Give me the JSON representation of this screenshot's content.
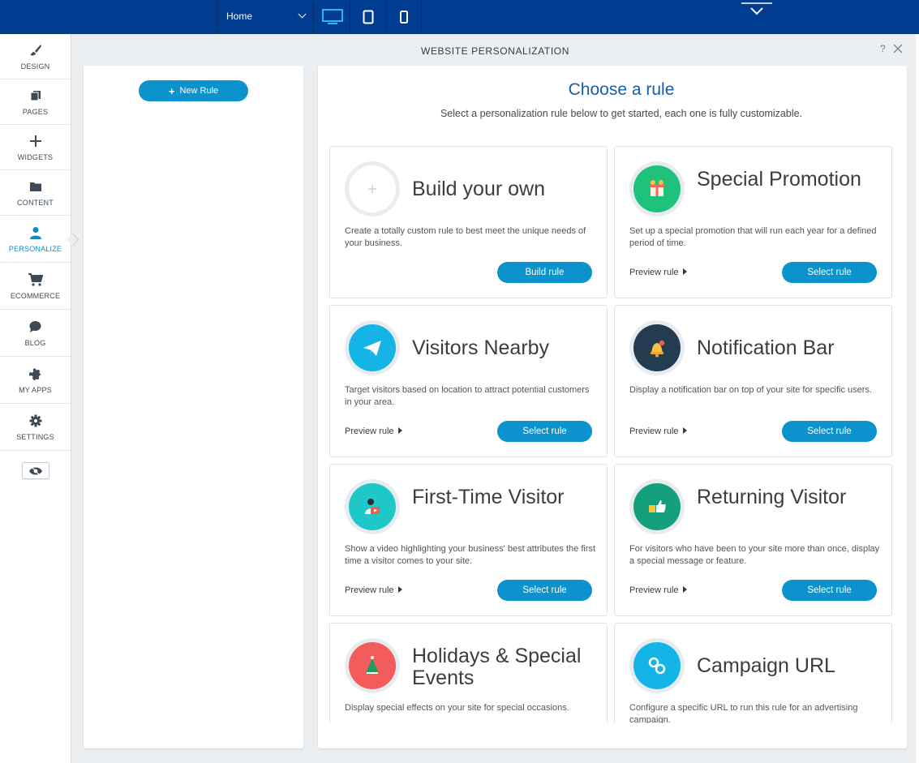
{
  "topbar": {
    "page_select_value": "Home",
    "devices": [
      "desktop-icon",
      "tablet-icon",
      "mobile-icon"
    ],
    "active_device": "desktop",
    "bg_color": "#003c8f"
  },
  "sidebar": {
    "items": [
      {
        "label": "DESIGN",
        "icon": "paintbrush-icon"
      },
      {
        "label": "PAGES",
        "icon": "pages-icon"
      },
      {
        "label": "WIDGETS",
        "icon": "plus-icon"
      },
      {
        "label": "CONTENT",
        "icon": "folder-icon"
      },
      {
        "label": "PERSONALIZE",
        "icon": "person-icon",
        "active": true
      },
      {
        "label": "ECOMMERCE",
        "icon": "cart-icon"
      },
      {
        "label": "BLOG",
        "icon": "chat-bubble-icon"
      },
      {
        "label": "MY APPS",
        "icon": "puzzle-icon"
      },
      {
        "label": "SETTINGS",
        "icon": "gear-icon"
      }
    ],
    "preview_icon": "eye-icon"
  },
  "panel": {
    "title": "WEBSITE PERSONALIZATION",
    "help": "?"
  },
  "rules_panel": {
    "new_rule_label": "New Rule"
  },
  "main": {
    "title": "Choose a rule",
    "subtitle": "Select a personalization rule below to get started, each one is fully customizable.",
    "preview_label": "Preview rule",
    "select_label": "Select rule",
    "build_label": "Build rule",
    "cards": [
      {
        "title": "Build your own",
        "desc": "Create a totally custom rule to best meet the unique needs of your business.",
        "icon": "plus-circle-icon",
        "color": "#ffffff"
      },
      {
        "title": "Special Promotion",
        "desc": "Set up a special promotion that will run each year for a defined period of time.",
        "icon": "gift-icon",
        "color": "#1fc27d"
      },
      {
        "title": "Visitors Nearby",
        "desc": "Target visitors based on location to attract potential customers in your area.",
        "icon": "paper-plane-icon",
        "color": "#14b5e6"
      },
      {
        "title": "Notification Bar",
        "desc": "Display a notification bar on top of your site for specific users.",
        "icon": "bell-icon",
        "color": "#233c52"
      },
      {
        "title": "First-Time Visitor",
        "desc": "Show a video highlighting your business' best attributes the first time a visitor comes to your site.",
        "icon": "video-person-icon",
        "color": "#1ec8c8"
      },
      {
        "title": "Returning Visitor",
        "desc": "For visitors who have been to your site more than once, display a special message or feature.",
        "icon": "thumbs-up-icon",
        "color": "#14a07c"
      },
      {
        "title": "Holidays & Special Events",
        "desc": "Display special effects on your site for special occasions.",
        "icon": "tree-icon",
        "color": "#f25c5c"
      },
      {
        "title": "Campaign URL",
        "desc": "Configure a specific URL to run this rule for an advertising campaign.",
        "icon": "link-icon",
        "color": "#14b5e6"
      }
    ]
  }
}
